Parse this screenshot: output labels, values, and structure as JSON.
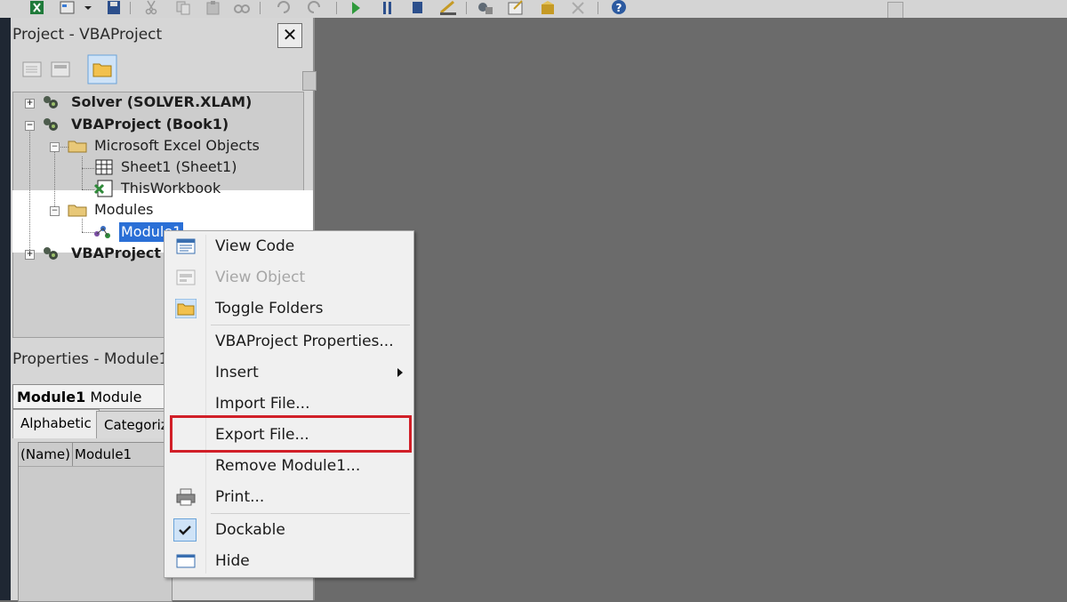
{
  "toolbar": {
    "buttons": [
      "excel-icon",
      "insert-userform-icon",
      "dropdown-arrow-icon",
      "save-icon",
      "cut-icon",
      "copy-icon",
      "paste-icon",
      "find-icon",
      "undo-icon",
      "redo-icon",
      "run-icon",
      "break-icon",
      "reset-icon",
      "design-mode-icon",
      "project-explorer-icon",
      "properties-icon",
      "object-browser-icon",
      "toolbox-icon",
      "help-icon"
    ]
  },
  "project": {
    "title": "Project - VBAProject",
    "close_symbol": "✕",
    "tree": [
      {
        "label": "Solver (SOLVER.XLAM)",
        "bold": true,
        "expander": "+",
        "icon": "vba-project-icon"
      },
      {
        "label": "VBAProject (Book1)",
        "bold": true,
        "expander": "−",
        "icon": "vba-project-icon"
      },
      {
        "label": "Microsoft Excel Objects",
        "bold": false,
        "expander": "−",
        "icon": "folder-icon"
      },
      {
        "label": "Sheet1 (Sheet1)",
        "bold": false,
        "icon": "sheet-icon"
      },
      {
        "label": "ThisWorkbook",
        "bold": false,
        "icon": "workbook-icon"
      },
      {
        "label": "Modules",
        "bold": false,
        "expander": "−",
        "icon": "folder-icon"
      },
      {
        "label": "Module1",
        "bold": false,
        "icon": "module-icon",
        "selected": true
      },
      {
        "label": "VBAProject (",
        "bold": true,
        "expander": "+",
        "icon": "vba-project-icon"
      }
    ]
  },
  "properties": {
    "title": "Properties - Module1",
    "combo_name": "Module1",
    "combo_type": "Module",
    "tabs": [
      "Alphabetic",
      "Categoriz"
    ],
    "rows": [
      {
        "name": "(Name)",
        "value": "Module1"
      }
    ]
  },
  "context_menu": {
    "items": [
      {
        "label": "View Code",
        "icon": "view-code-icon",
        "disabled": false
      },
      {
        "label": "View Object",
        "icon": "view-object-icon",
        "disabled": true
      },
      {
        "label": "Toggle Folders",
        "icon": "folder-icon",
        "disabled": false
      },
      {
        "label": "VBAProject Properties...",
        "disabled": false
      },
      {
        "label": "Insert",
        "disabled": false,
        "submenu": true
      },
      {
        "label": "Import File...",
        "disabled": false
      },
      {
        "label": "Export File...",
        "disabled": false,
        "highlighted": true
      },
      {
        "label": "Remove Module1...",
        "disabled": false
      },
      {
        "label": "Print...",
        "icon": "printer-icon",
        "disabled": false
      },
      {
        "label": "Dockable",
        "icon": "checkmark-icon",
        "checked": true,
        "disabled": false
      },
      {
        "label": "Hide",
        "icon": "window-icon",
        "disabled": false
      }
    ]
  },
  "colors": {
    "highlight_border": "#d11f28",
    "selection": "#2a6fd6",
    "background": "#6b6b6b"
  }
}
